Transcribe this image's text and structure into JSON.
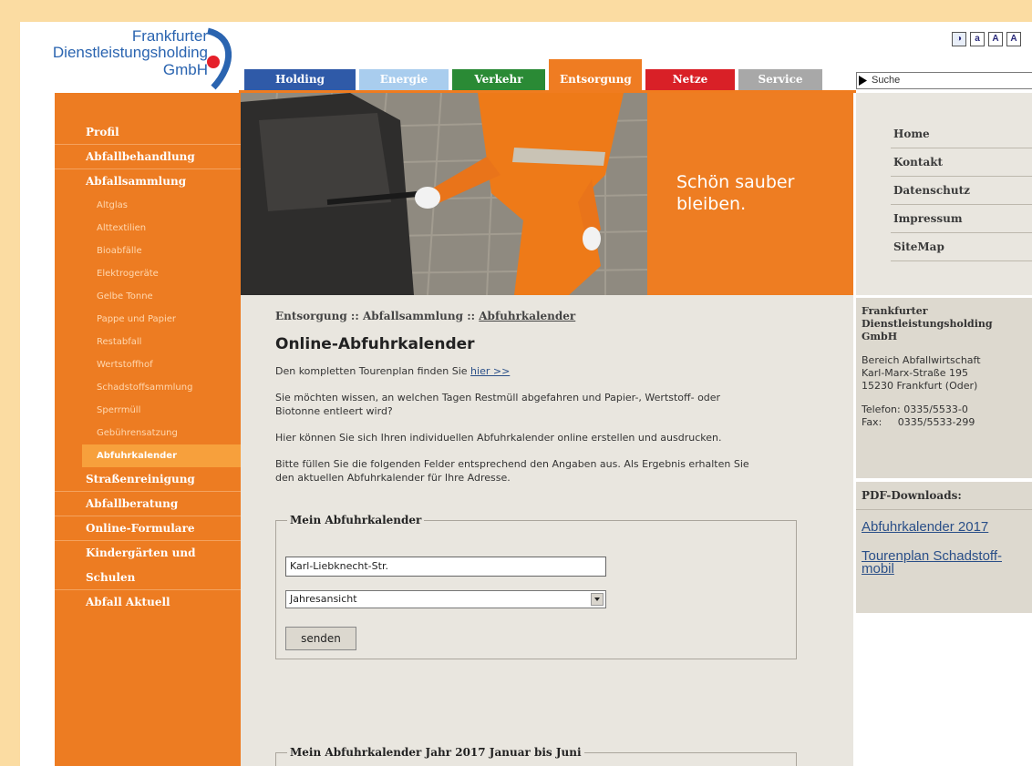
{
  "logo": {
    "line1": "Frankfurter",
    "line2": "Dienstleistungsholding",
    "line3": "GmbH"
  },
  "accessibility": {
    "contrast": "◑",
    "small": "a",
    "medium": "A",
    "large": "A"
  },
  "tabs": [
    {
      "label": "Holding",
      "color": "#2f5aa8"
    },
    {
      "label": "Energie",
      "color": "#a9cdee"
    },
    {
      "label": "Verkehr",
      "color": "#2a8a35"
    },
    {
      "label": "Entsorgung",
      "color": "#ef7c22",
      "active": true
    },
    {
      "label": "Netze",
      "color": "#d92027"
    },
    {
      "label": "Service",
      "color": "#a8a8a8"
    }
  ],
  "search": {
    "value": "Suche"
  },
  "leftnav": {
    "profil": "Profil",
    "abfallbehandlung": "Abfallbehandlung",
    "abfallsammlung": "Abfallsammlung",
    "sub": [
      "Altglas",
      "Alttextilien",
      "Bioabfälle",
      "Elektrogeräte",
      "Gelbe Tonne",
      "Pappe und Papier",
      "Restabfall",
      "Wertstoffhof",
      "Schadstoffsammlung",
      "Sperrmüll",
      "Gebührensatzung",
      "Abfuhrkalender"
    ],
    "strassenreinigung": "Straßenreinigung",
    "abfallberatung": "Abfallberatung",
    "formulare": "Online-Formulare",
    "kita1": "Kindergärten und",
    "kita2": "Schulen",
    "aktuell": "Abfall Aktuell"
  },
  "hero": {
    "text": "Schön sauber\nbleiben."
  },
  "rightnav": [
    "Home",
    "Kontakt",
    "Datenschutz",
    "Impressum",
    "SiteMap"
  ],
  "contact": {
    "name": "Frankfurter\nDienstleistungsholding\nGmbH",
    "address": "Bereich Abfallwirtschaft\nKarl-Marx-Straße 195\n15230 Frankfurt (Oder)",
    "phone": "Telefon: 0335/5533-0\nFax:     0335/5533-299"
  },
  "pdf": {
    "heading": "PDF-Downloads:",
    "link1": "Abfuhrkalender 2017",
    "link2": "Tourenplan Schadstoff-\nmobil"
  },
  "content": {
    "crumb1": "Entsorgung :: Abfallsammlung :: ",
    "crumb2": "Abfuhrkalender",
    "title": "Online-Abfuhrkalender",
    "p1": "Den kompletten Tourenplan finden Sie ",
    "p1link": "hier >>",
    "p2": "Sie möchten wissen, an welchen Tagen Restmüll abgefahren und Papier-, Wertstoff- oder Biotonne entleert wird?",
    "p3": "Hier können Sie sich Ihren individuellen Abfuhrkalender online erstellen und ausdrucken.",
    "p4": "Bitte füllen Sie die folgenden Felder entsprechend den Angaben aus. Als Ergebnis erhalten Sie den aktuellen Abfuhrkalender für Ihre Adresse.",
    "form_legend": "Mein Abfuhrkalender",
    "street_value": "Karl-Liebknecht-Str.",
    "view_value": "Jahresansicht",
    "submit": "senden",
    "result_legend": "Mein Abfuhrkalender Jahr 2017 Januar bis Juni"
  }
}
